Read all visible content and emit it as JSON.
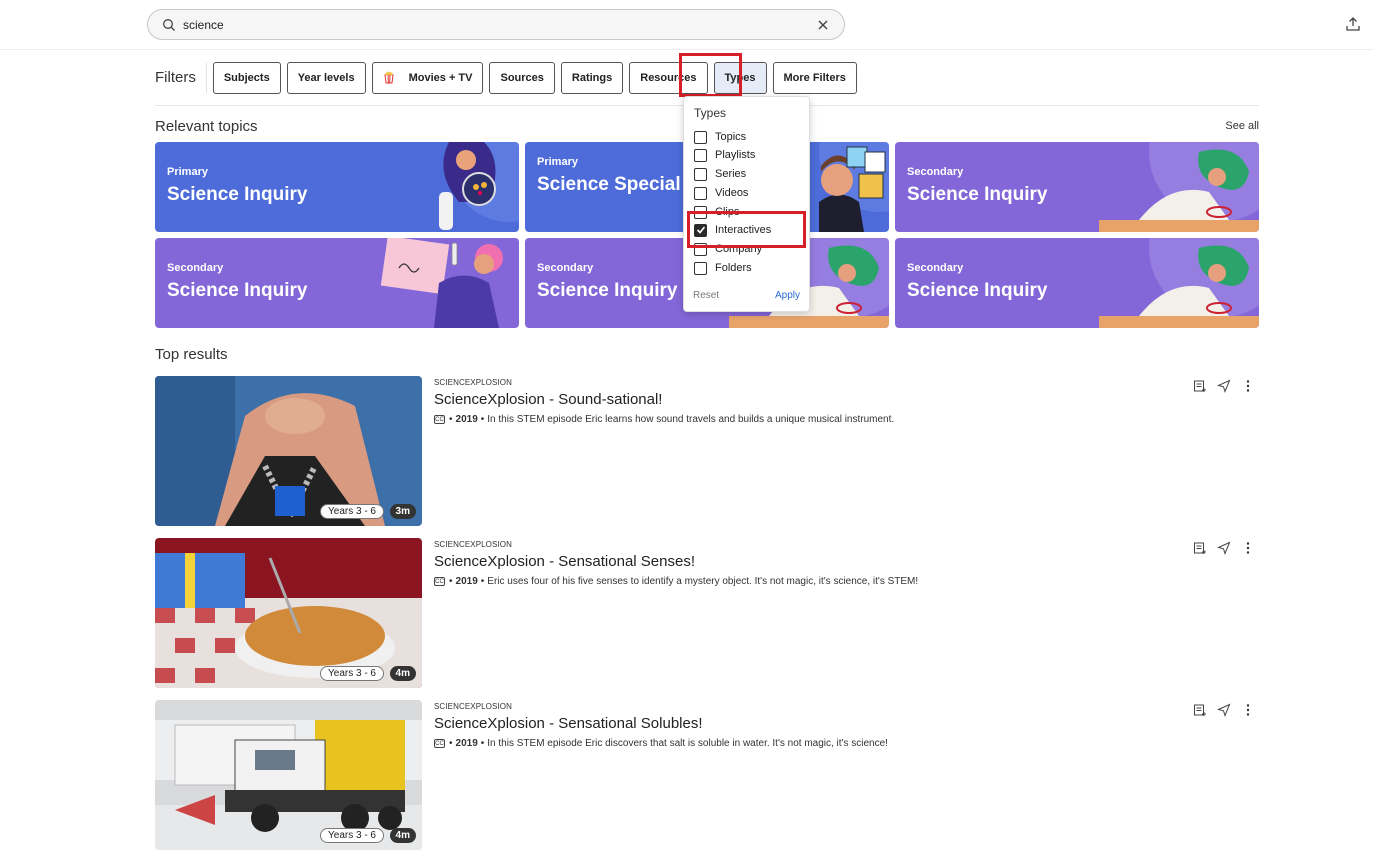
{
  "search": {
    "value": "science",
    "placeholder": ""
  },
  "filters": {
    "label": "Filters",
    "buttons": [
      "Subjects",
      "Year levels",
      "Movies + TV",
      "Sources",
      "Ratings",
      "Resources",
      "Types",
      "More Filters"
    ],
    "active": "Types"
  },
  "types_dropdown": {
    "heading": "Types",
    "options": [
      {
        "label": "Topics",
        "checked": false
      },
      {
        "label": "Playlists",
        "checked": false
      },
      {
        "label": "Series",
        "checked": false
      },
      {
        "label": "Videos",
        "checked": false
      },
      {
        "label": "Clips",
        "checked": false
      },
      {
        "label": "Interactives",
        "checked": true
      },
      {
        "label": "Company",
        "checked": false
      },
      {
        "label": "Folders",
        "checked": false
      }
    ],
    "reset": "Reset",
    "apply": "Apply"
  },
  "topics": {
    "title": "Relevant topics",
    "see_all": "See all",
    "cards": [
      {
        "level": "Primary",
        "title": "Science Inquiry"
      },
      {
        "level": "Primary",
        "title": "Science Special Events"
      },
      {
        "level": "Secondary",
        "title": "Science Inquiry"
      },
      {
        "level": "Secondary",
        "title": "Science Inquiry"
      },
      {
        "level": "Secondary",
        "title": "Science Inquiry"
      },
      {
        "level": "Secondary",
        "title": "Science Inquiry"
      }
    ]
  },
  "results": {
    "title": "Top results",
    "items": [
      {
        "source": "SCIENCEXPLOSION",
        "title": "ScienceXplosion - Sound-sational!",
        "cc": "CC",
        "year": "2019",
        "desc": "In this STEM episode Eric learns how sound travels and builds a unique musical instrument.",
        "years": "Years 3 - 6",
        "duration": "3m"
      },
      {
        "source": "SCIENCEXPLOSION",
        "title": "ScienceXplosion - Sensational Senses!",
        "cc": "CC",
        "year": "2019",
        "desc": "Eric uses four of his five senses to identify a mystery object. It's not magic, it's science, it's STEM!",
        "years": "Years 3 - 6",
        "duration": "4m"
      },
      {
        "source": "SCIENCEXPLOSION",
        "title": "ScienceXplosion - Sensational Solubles!",
        "cc": "CC",
        "year": "2019",
        "desc": "In this STEM episode Eric discovers that salt is soluble in water. It's not magic, it's science!",
        "years": "Years 3 - 6",
        "duration": "4m"
      }
    ]
  },
  "colors": {
    "primary_card": "#4d6cd9",
    "secondary_card": "#8367d8",
    "highlight": "#d61f26",
    "apply": "#2a6ad6"
  }
}
